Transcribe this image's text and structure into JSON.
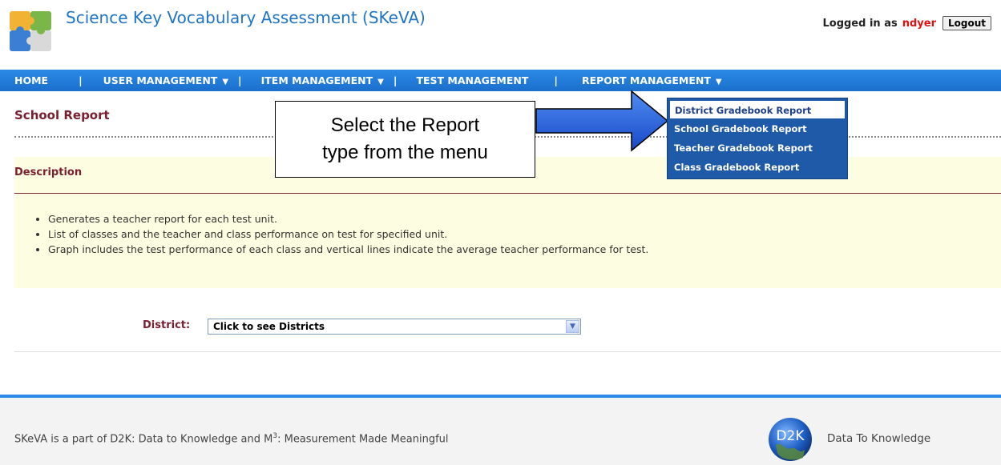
{
  "header": {
    "title": "Science Key Vocabulary Assessment (SKeVA)",
    "logged_in_label": "Logged in as",
    "username": "ndyer",
    "logout_label": "Logout"
  },
  "nav": {
    "items": [
      {
        "label": "HOME",
        "has_caret": false
      },
      {
        "label": "USER MANAGEMENT",
        "has_caret": true
      },
      {
        "label": "ITEM MANAGEMENT",
        "has_caret": true
      },
      {
        "label": "TEST MANAGEMENT",
        "has_caret": false
      },
      {
        "label": "REPORT MANAGEMENT",
        "has_caret": true
      }
    ],
    "separator": "|"
  },
  "report_menu": {
    "items": [
      "District Gradebook Report",
      "School Gradebook Report",
      "Teacher Gradebook Report",
      "Class Gradebook Report"
    ],
    "highlighted_index": 0
  },
  "page": {
    "title": "School Report"
  },
  "callout": {
    "line1": "Select the Report",
    "line2": "type from the menu"
  },
  "description": {
    "heading": "Description",
    "bullets": [
      "Generates a teacher report for each test unit.",
      "List of classes and the teacher and class performance on test for specified unit.",
      "Graph includes the test performance of each class and vertical lines indicate the average teacher performance for test."
    ]
  },
  "form": {
    "district_label": "District:",
    "district_value": "Click to see Districts"
  },
  "footer": {
    "text_before": "SKeVA is a part of D2K: Data to Knowledge and M",
    "superscript": "3",
    "text_after": ": Measurement Made Meaningful",
    "logo_text": "D2K",
    "right_text": "Data To Knowledge"
  },
  "colors": {
    "brand_blue": "#1f74c4",
    "nav_blue": "#2a8ae6",
    "maroon": "#7a2030",
    "username_red": "#e01010",
    "panel_yellow": "#fdfde1"
  }
}
